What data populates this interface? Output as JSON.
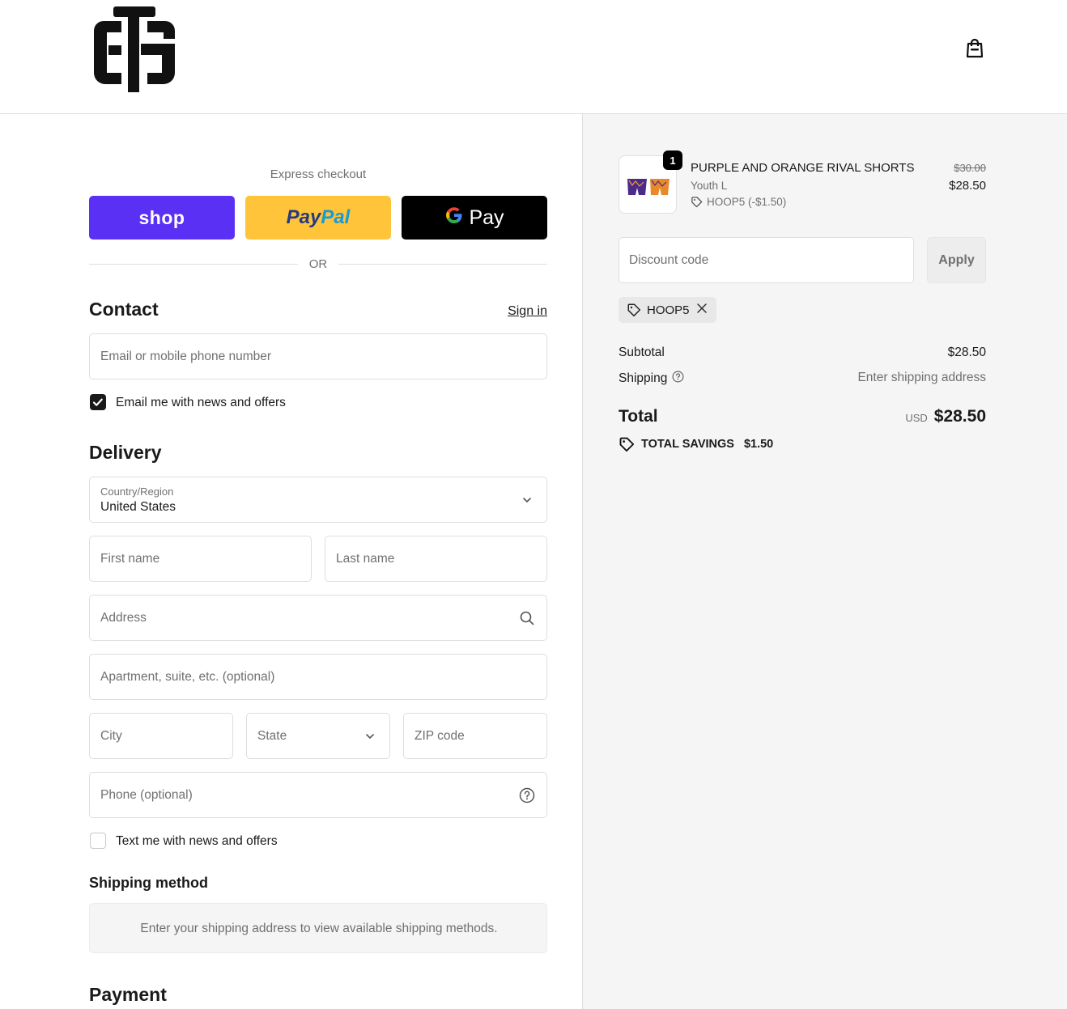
{
  "header": {
    "logo_icon": "store-monogram-logo",
    "cart_icon": "shopping-bag-icon"
  },
  "express": {
    "label": "Express checkout",
    "shop_label": "shop",
    "paypal_part1": "Pay",
    "paypal_part2": "Pal",
    "gpay_g": "G",
    "gpay_label": "Pay",
    "or_label": "OR"
  },
  "contact": {
    "title": "Contact",
    "sign_in": "Sign in",
    "email_placeholder": "Email or mobile phone number",
    "email_opt_in_label": "Email me with news and offers",
    "email_opt_in_checked": true
  },
  "delivery": {
    "title": "Delivery",
    "country_label": "Country/Region",
    "country_value": "United States",
    "first_name_placeholder": "First name",
    "last_name_placeholder": "Last name",
    "address_placeholder": "Address",
    "apartment_placeholder": "Apartment, suite, etc. (optional)",
    "city_placeholder": "City",
    "state_placeholder": "State",
    "zip_placeholder": "ZIP code",
    "phone_placeholder": "Phone (optional)",
    "sms_opt_in_label": "Text me with news and offers",
    "sms_opt_in_checked": false
  },
  "shipping_method": {
    "title": "Shipping method",
    "message": "Enter your shipping address to view available shipping methods."
  },
  "payment": {
    "title": "Payment"
  },
  "summary": {
    "item": {
      "quantity": "1",
      "name": "PURPLE AND ORANGE RIVAL SHORTS",
      "variant": "Youth L",
      "discount": "HOOP5 (-$1.50)",
      "original_price": "$30.00",
      "price": "$28.50"
    },
    "discount_placeholder": "Discount code",
    "apply_label": "Apply",
    "applied_code": "HOOP5",
    "subtotal_label": "Subtotal",
    "subtotal_value": "$28.50",
    "shipping_label": "Shipping",
    "shipping_value": "Enter shipping address",
    "total_label": "Total",
    "currency": "USD",
    "total_value": "$28.50",
    "savings_label": "TOTAL SAVINGS",
    "savings_value": "$1.50"
  },
  "colors": {
    "shop_pay": "#5a31f4",
    "paypal": "#ffc439",
    "gpay": "#000000",
    "summary_bg": "#f5f5f5"
  }
}
